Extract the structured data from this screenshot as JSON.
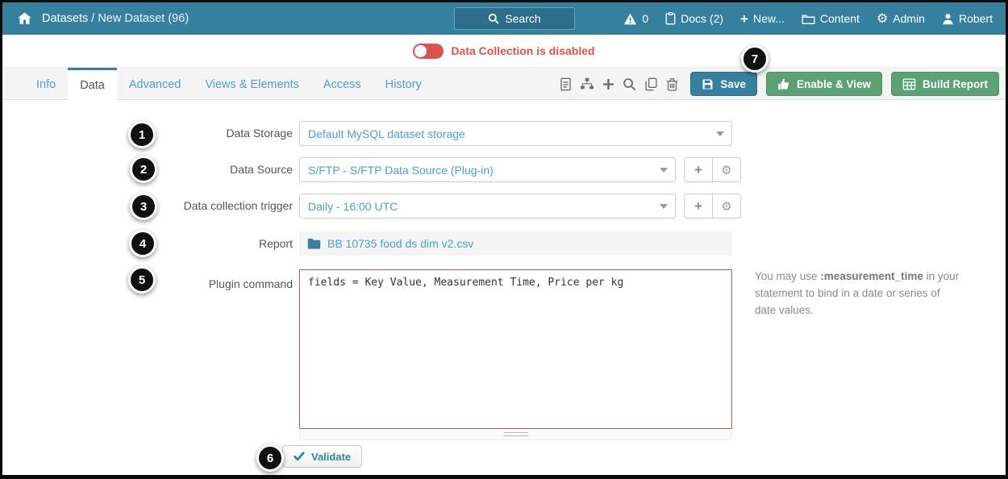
{
  "topbar": {
    "breadcrumb_section": "Datasets",
    "breadcrumb_current": " / New Dataset (96)",
    "search_label": "Search",
    "alerts_count": "0",
    "docs_label": "Docs (2)",
    "new_label": "New...",
    "content_label": "Content",
    "admin_label": "Admin",
    "user_label": "Robert"
  },
  "banner": {
    "message": "Data Collection is disabled"
  },
  "tabs": [
    {
      "label": "Info"
    },
    {
      "label": "Data"
    },
    {
      "label": "Advanced"
    },
    {
      "label": "Views & Elements"
    },
    {
      "label": "Access"
    },
    {
      "label": "History"
    }
  ],
  "toolbar": {
    "save_label": "Save",
    "enable_view_label": "Enable & View",
    "build_report_label": "Build Report"
  },
  "form": {
    "data_storage_label": "Data Storage",
    "data_storage_value": "Default MySQL dataset storage",
    "data_source_label": "Data Source",
    "data_source_value": "S/FTP - S/FTP Data Source (Plug-in)",
    "trigger_label": "Data collection trigger",
    "trigger_value": "Daily - 16:00 UTC",
    "report_label": "Report",
    "report_value": "BB 10735 food ds dim v2.csv",
    "plugin_label": "Plugin command",
    "plugin_value": "fields = Key Value, Measurement Time, Price per kg",
    "validate_label": "Validate"
  },
  "help": {
    "prefix": "You may use ",
    "token": ":measurement_time",
    "suffix": " in your statement to bind in a date or series of date values."
  },
  "annotations": [
    "1",
    "2",
    "3",
    "4",
    "5",
    "6",
    "7"
  ],
  "colors": {
    "topbar_teal": "#35809e",
    "danger_red": "#d9534f",
    "link_blue": "#4a9fce",
    "button_green": "#5ba173",
    "validate_teal": "#2b8a8a"
  },
  "icons": {
    "home": "house",
    "alerts": "warning-triangle",
    "docs": "clipboard",
    "new": "plus",
    "content": "folder",
    "admin": "gear",
    "user": "person",
    "search": "magnifier",
    "toolbar_icons": [
      "document",
      "sitemap",
      "plus",
      "magnifier",
      "copy",
      "trash"
    ],
    "save": "floppy-disk",
    "enable_view": "thumbs-up",
    "build_report": "table",
    "report_field": "folder",
    "validate": "check",
    "dropdown": "chevron-down"
  }
}
